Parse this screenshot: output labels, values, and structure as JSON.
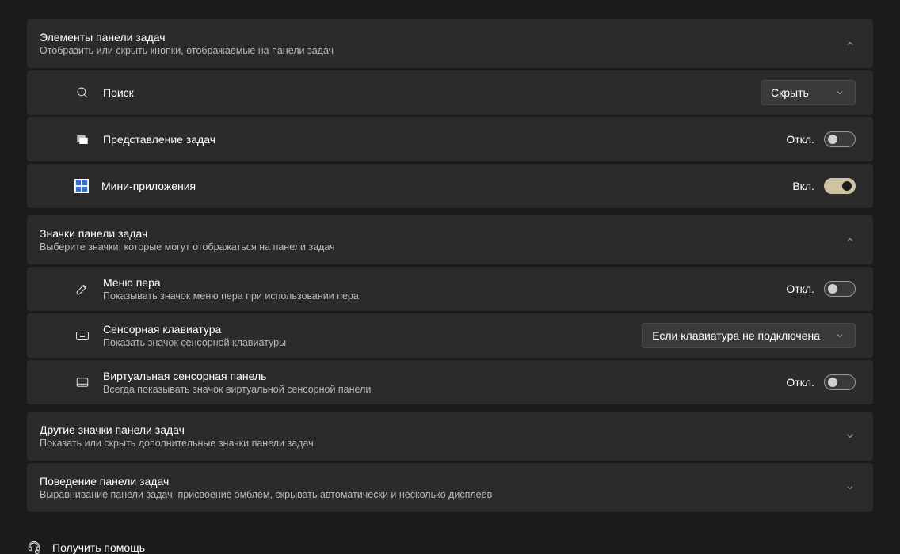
{
  "sections": {
    "elements": {
      "title": "Элементы панели задач",
      "subtitle": "Отобразить или скрыть кнопки, отображаемые на панели задач",
      "rows": {
        "search": {
          "label": "Поиск",
          "dropdown": "Скрыть"
        },
        "taskview": {
          "label": "Представление задач",
          "state": "Откл."
        },
        "widgets": {
          "label": "Мини-приложения",
          "state": "Вкл."
        }
      }
    },
    "icons": {
      "title": "Значки панели задач",
      "subtitle": "Выберите значки, которые могут отображаться на панели задач",
      "rows": {
        "pen": {
          "label": "Меню пера",
          "sub": "Показывать значок меню пера при использовании пера",
          "state": "Откл."
        },
        "touchkbd": {
          "label": "Сенсорная клавиатура",
          "sub": "Показать значок сенсорной клавиатуры",
          "dropdown": "Если клавиатура не подключена"
        },
        "touchpad": {
          "label": "Виртуальная сенсорная панель",
          "sub": "Всегда показывать значок виртуальной сенсорной панели",
          "state": "Откл."
        }
      }
    },
    "other": {
      "title": "Другие значки панели задач",
      "subtitle": "Показать или скрыть дополнительные значки панели задач"
    },
    "behavior": {
      "title": "Поведение панели задач",
      "subtitle": "Выравнивание панели задач, присвоение эмблем, скрывать автоматически и несколько дисплеев"
    }
  },
  "help": "Получить помощь"
}
